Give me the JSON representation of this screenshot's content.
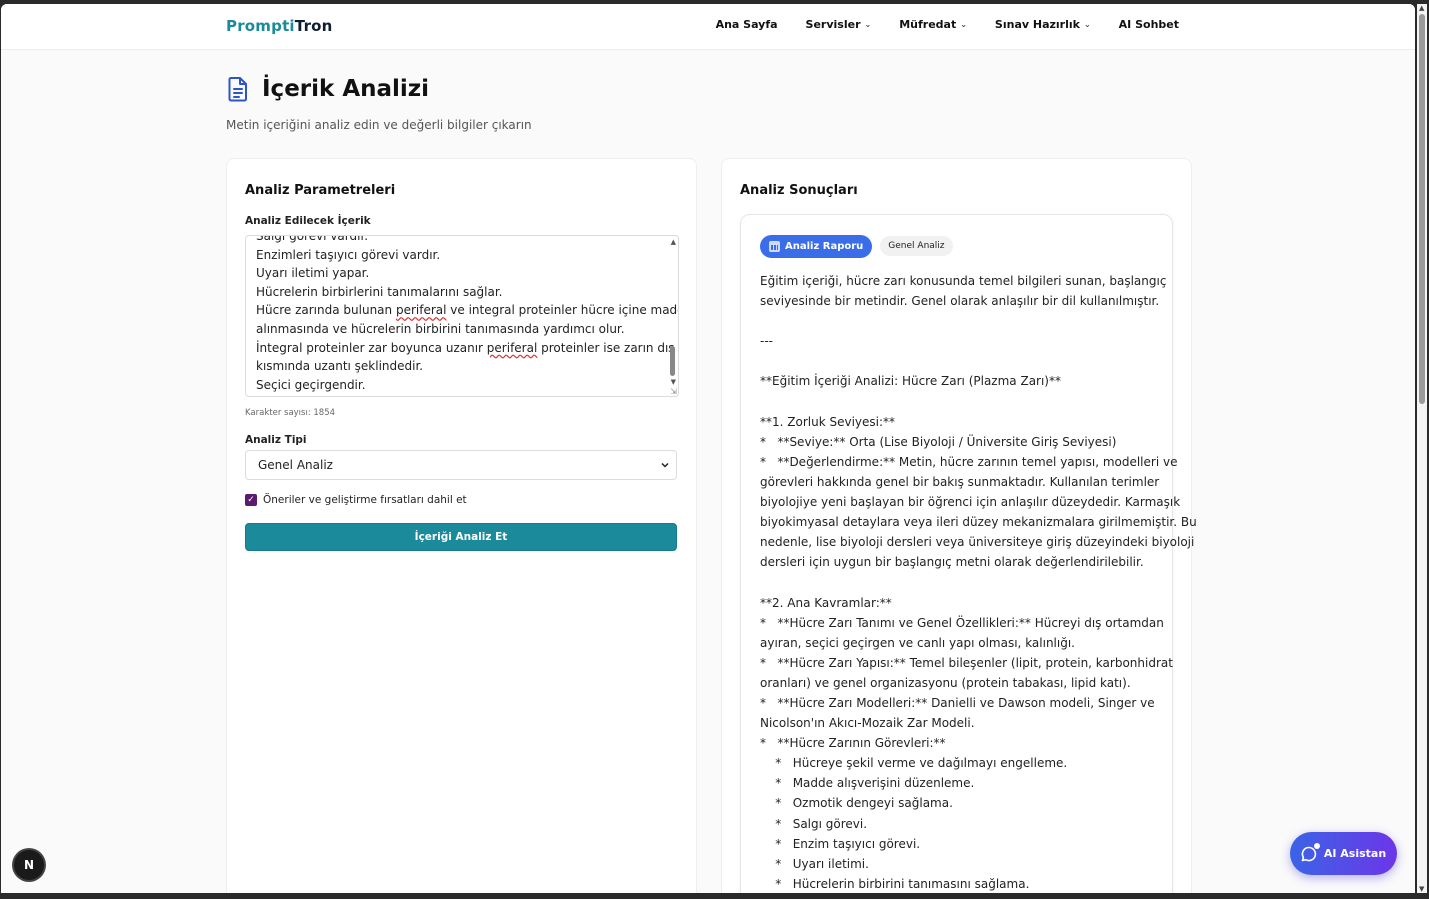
{
  "nav": {
    "brand_part1": "Prompti",
    "brand_part2": "Tron",
    "links": [
      "Ana Sayfa",
      "Servisler",
      "Müfredat",
      "Sınav Hazırlık",
      "AI Sohbet"
    ]
  },
  "page": {
    "title": "İçerik Analizi",
    "subtitle": "Metin içeriğini analiz edin ve değerli bilgiler çıkarın"
  },
  "left": {
    "card_title": "Analiz Parametreleri",
    "content_label": "Analiz Edilecek İçerik",
    "textarea_lines": [
      "Salgı görevi vardır.",
      "Enzimleri taşıyıcı görevi vardır.",
      "Uyarı iletimi yapar.",
      "Hücrelerin birbirlerini tanımalarını sağlar.",
      "Hücre zarında bulunan periferal ve integral proteinler hücre içine madde",
      "alınmasında ve hücrelerin birbirini tanımasında yardımcı olur.",
      "İntegral proteinler zar boyunca uzanır periferal proteinler ise zarın dış",
      "kısmında uzantı şeklindedir.",
      "Seçici geçirgendir."
    ],
    "char_count": "Karakter sayısı: 1854",
    "type_label": "Analiz Tipi",
    "type_value": "Genel Analiz",
    "checkbox_label": "Öneriler ve geliştirme fırsatları dahil et",
    "checkbox_checked": true,
    "submit_label": "İçeriği Analiz Et"
  },
  "right": {
    "card_title": "Analiz Sonuçları",
    "tab_active": "Analiz Raporu",
    "tab_inactive": "Genel Analiz",
    "lines": [
      "Eğitim içeriği, hücre zarı konusunda temel bilgileri sunan, başlangıç",
      "seviyesinde bir metindir. Genel olarak anlaşılır bir dil kullanılmıştır.",
      "",
      "---",
      "",
      "**Eğitim İçeriği Analizi: Hücre Zarı (Plazma Zarı)**",
      "",
      "**1. Zorluk Seviyesi:**",
      "*   **Seviye:** Orta (Lise Biyoloji / Üniversite Giriş Seviyesi)",
      "*   **Değerlendirme:** Metin, hücre zarının temel yapısı, modelleri ve",
      "görevleri hakkında genel bir bakış sunmaktadır. Kullanılan terimler",
      "biyolojiye yeni başlayan bir öğrenci için anlaşılır düzeydedir. Karmaşık",
      "biyokimyasal detaylara veya ileri düzey mekanizmalara girilmemiştir. Bu",
      "nedenle, lise biyoloji dersleri veya üniversiteye giriş düzeyindeki biyoloji",
      "dersleri için uygun bir başlangıç metni olarak değerlendirilebilir.",
      "",
      "**2. Ana Kavramlar:**",
      "*   **Hücre Zarı Tanımı ve Genel Özellikleri:** Hücreyi dış ortamdan",
      "ayıran, seçici geçirgen ve canlı yapı olması, kalınlığı.",
      "*   **Hücre Zarı Yapısı:** Temel bileşenler (lipit, protein, karbonhidrat",
      "oranları) ve genel organizasyonu (protein tabakası, lipid katı).",
      "*   **Hücre Zarı Modelleri:** Danielli ve Dawson modeli, Singer ve",
      "Nicolson'ın Akıcı-Mozaik Zar Modeli.",
      "*   **Hücre Zarının Görevleri:**",
      "    *   Hücreye şekil verme ve dağılmayı engelleme.",
      "    *   Madde alışverişini düzenleme.",
      "    *   Ozmotik dengeyi sağlama.",
      "    *   Salgı görevi.",
      "    *   Enzim taşıyıcı görevi.",
      "    *   Uyarı iletimi.",
      "    *   Hücrelerin birbirini tanımasını sağlama."
    ]
  },
  "floating": {
    "n_badge": "N",
    "ai_button": "AI Asistan"
  }
}
